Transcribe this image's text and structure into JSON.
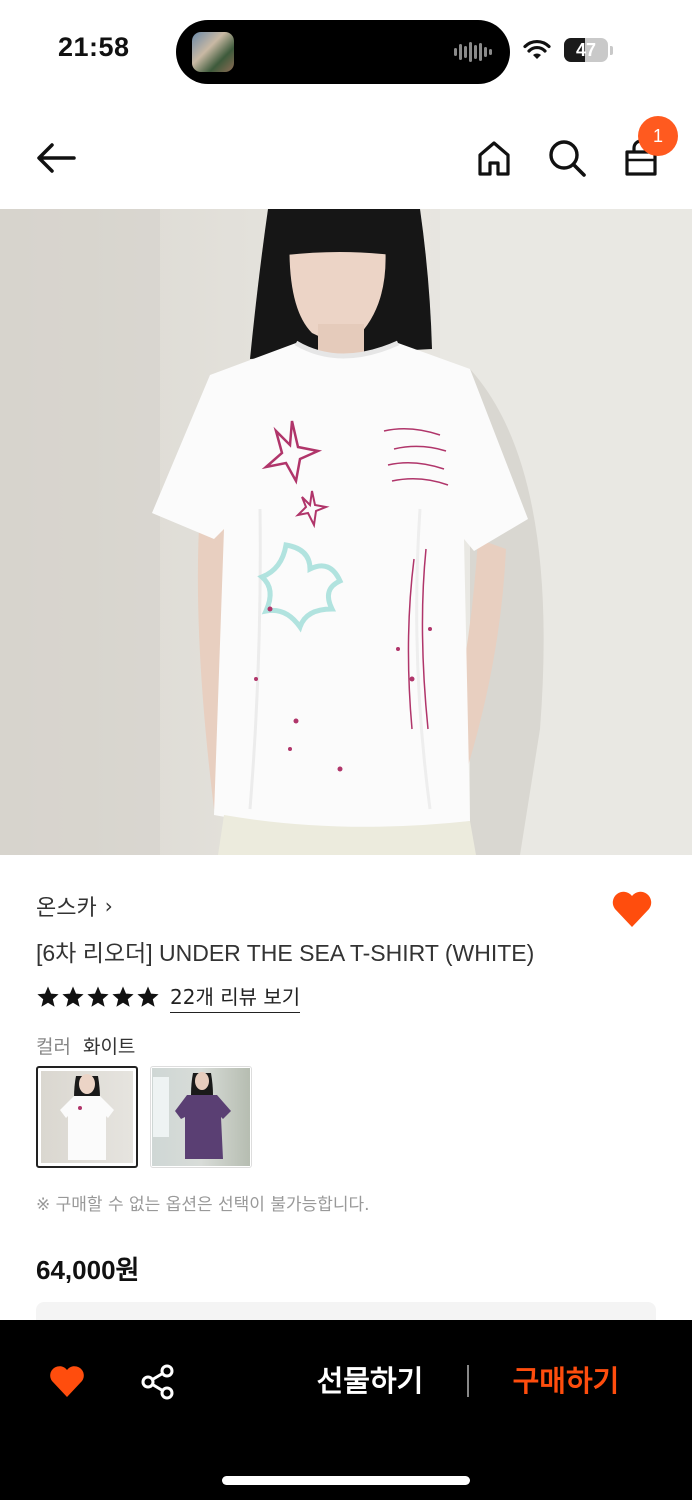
{
  "status_bar": {
    "time": "21:58",
    "battery": "47",
    "battery_level_percent": 47,
    "icons": [
      "wifi-icon",
      "battery-icon",
      "audio-wave-icon"
    ]
  },
  "nav": {
    "icons": [
      "back-arrow-icon",
      "home-icon",
      "search-icon",
      "shopping-bag-icon"
    ],
    "cart_count": "1",
    "badge_color": "#ff5a1f"
  },
  "product": {
    "brand": "온스카",
    "brand_chevron": "›",
    "title": "[6차 리오더] UNDER THE SEA T-SHIRT (WHITE)",
    "rating_stars": 5,
    "review_link": "22개 리뷰 보기",
    "color_label": "컬러",
    "color_value": "화이트",
    "notice": "※ 구매할 수 없는 옵션은 선택이 불가능합니다.",
    "price": "64,000원",
    "accent_color": "#ff4d0d"
  },
  "bottom_bar": {
    "gift_label": "선물하기",
    "buy_label": "구매하기"
  }
}
